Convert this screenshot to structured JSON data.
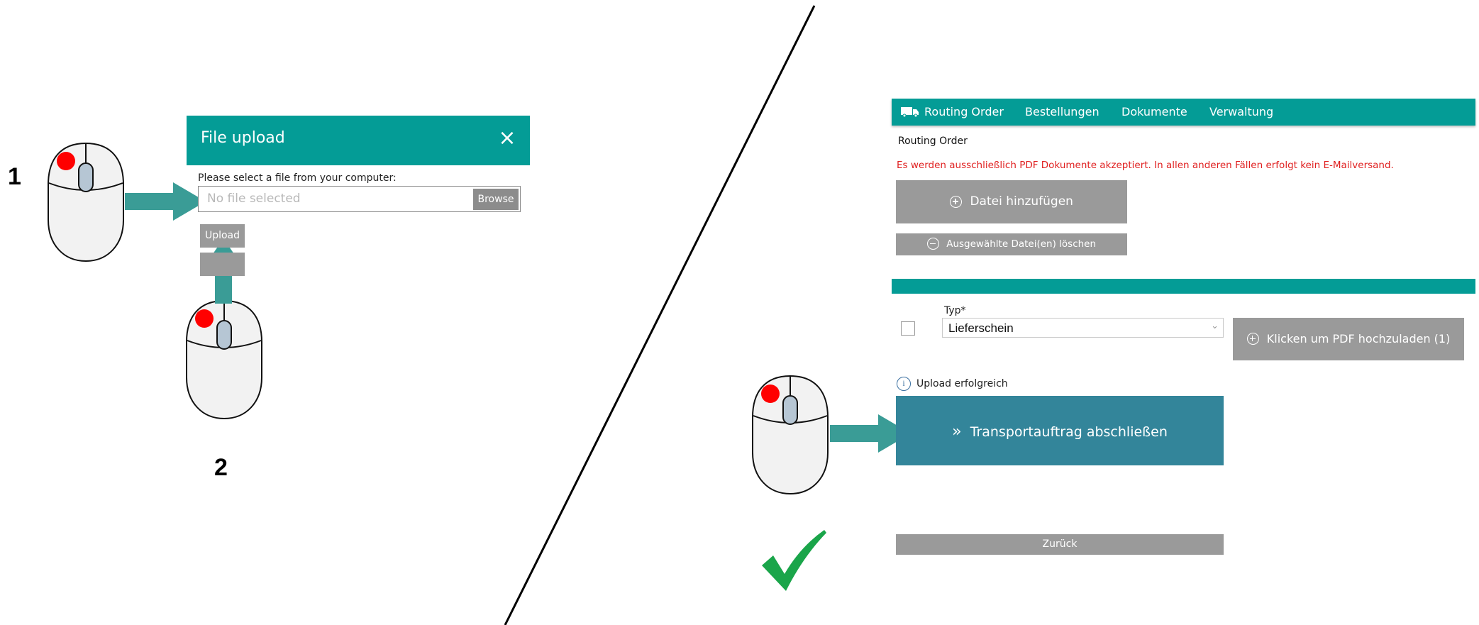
{
  "step_labels": {
    "step1": "1",
    "step2": "2"
  },
  "file_upload_dialog": {
    "title": "File upload",
    "close_icon": "×",
    "prompt": "Please select a file from your computer:",
    "file_placeholder": "No file selected",
    "browse_label": "Browse",
    "upload_label": "Upload"
  },
  "routing_page": {
    "nav": {
      "items": [
        "Routing Order",
        "Bestellungen",
        "Dokumente",
        "Verwaltung"
      ],
      "icon": "truck-icon"
    },
    "breadcrumb": "Routing Order",
    "warning": "Es werden ausschließlich PDF Dokumente akzeptiert. In allen anderen Fällen erfolgt kein E-Mailversand.",
    "add_file_label": "Datei hinzufügen",
    "delete_selected_label": "Ausgewählte Datei(en) löschen",
    "type_label": "Typ*",
    "type_value": "Lieferschein",
    "upload_pdf_label": "Klicken um PDF hochzuladen (1)",
    "upload_status": "Upload erfolgreich",
    "complete_label": "Transportauftrag abschließen",
    "back_label": "Zurück"
  },
  "colors": {
    "teal": "#049c96",
    "arrow_teal": "#3a9c96",
    "button_gray": "#9a9a9a",
    "primary_button": "#33859a",
    "warning_red": "#e02020",
    "checkmark_green": "#1aa54a",
    "mouse_red_dot": "#ff0000"
  }
}
